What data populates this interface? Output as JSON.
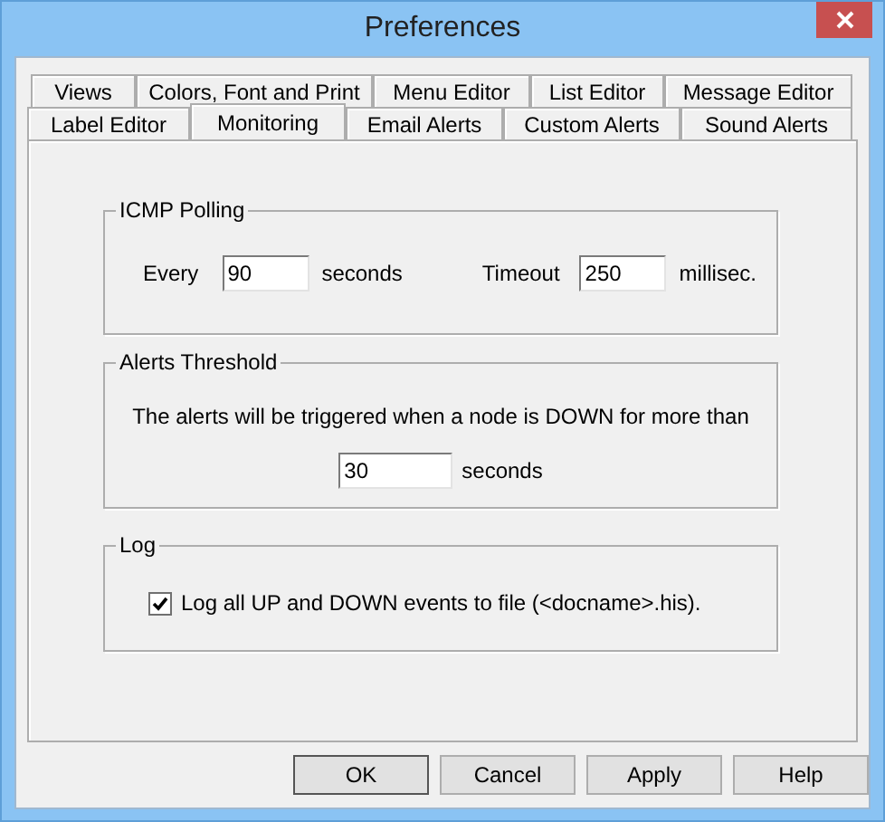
{
  "window": {
    "title": "Preferences"
  },
  "tab_rows": [
    {
      "tabs": [
        {
          "label": "Views",
          "selected": false
        },
        {
          "label": "Colors, Font and Print",
          "selected": false
        },
        {
          "label": "Menu Editor",
          "selected": false
        },
        {
          "label": "List Editor",
          "selected": false
        },
        {
          "label": "Message Editor",
          "selected": false
        }
      ]
    },
    {
      "tabs": [
        {
          "label": "Label Editor",
          "selected": false
        },
        {
          "label": "Monitoring",
          "selected": true
        },
        {
          "label": "Email Alerts",
          "selected": false
        },
        {
          "label": "Custom Alerts",
          "selected": false
        },
        {
          "label": "Sound Alerts",
          "selected": false
        }
      ]
    }
  ],
  "icmp_polling": {
    "title": "ICMP Polling",
    "every_label": "Every",
    "every_value": "90",
    "every_unit": "seconds",
    "timeout_label": "Timeout",
    "timeout_value": "250",
    "timeout_unit": "millisec."
  },
  "alerts_threshold": {
    "title": "Alerts Threshold",
    "message": "The alerts will be triggered when a node is DOWN for more than",
    "value": "30",
    "unit": "seconds"
  },
  "log": {
    "title": "Log",
    "checkbox": {
      "label": "Log all UP and DOWN events to file (<docname>.his).",
      "checked": true
    }
  },
  "buttons": [
    "OK",
    "Cancel",
    "Apply",
    "Help"
  ]
}
